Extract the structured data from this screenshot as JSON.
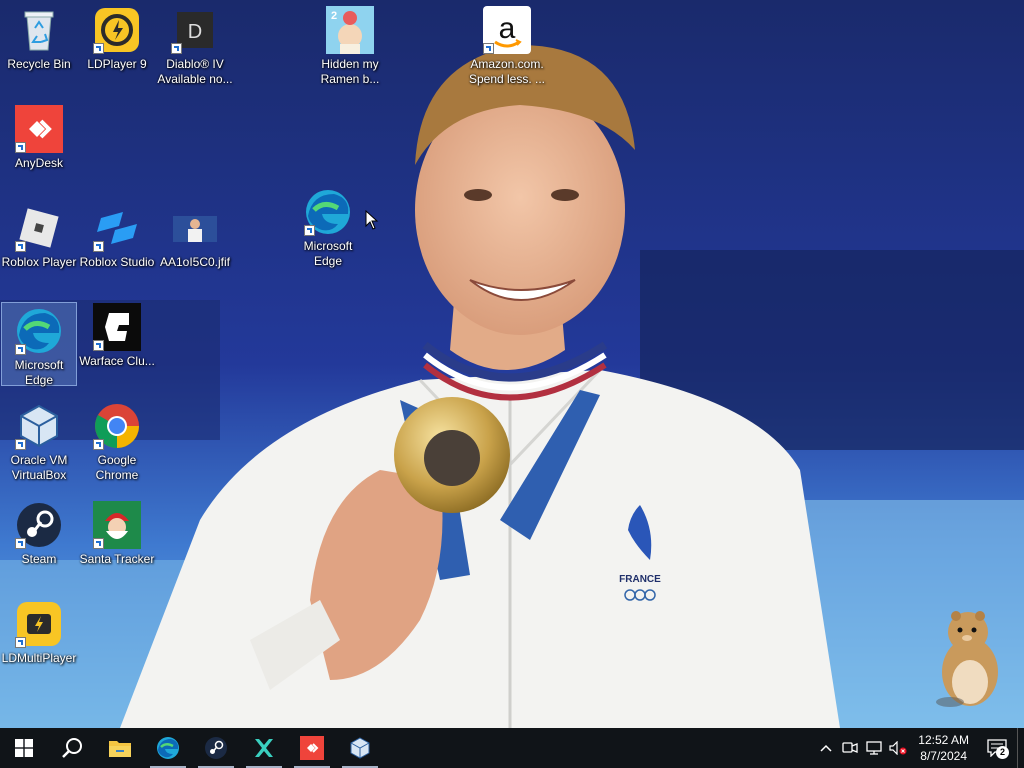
{
  "desktop": {
    "icons": [
      {
        "label": "Recycle Bin",
        "icon": "recycle-bin-icon"
      },
      {
        "label": "LDPlayer 9",
        "icon": "ldplayer-icon"
      },
      {
        "label": "Diablo® IV Available no...",
        "icon": "diablo-icon",
        "glyph": "D"
      },
      {
        "label": "Hidden my Ramen b...",
        "icon": "ramen-game-icon",
        "glyph": "2"
      },
      {
        "label": "Amazon.com. Spend less. ...",
        "icon": "amazon-icon",
        "glyph": "a"
      },
      {
        "label": "AnyDesk",
        "icon": "anydesk-icon"
      },
      {
        "label": "Roblox Player",
        "icon": "roblox-player-icon"
      },
      {
        "label": "Roblox Studio",
        "icon": "roblox-studio-icon"
      },
      {
        "label": "AA1oI5C0.jfif",
        "icon": "image-file-icon"
      },
      {
        "label": "Microsoft Edge",
        "icon": "edge-icon"
      },
      {
        "label": "Microsoft Edge",
        "icon": "edge-icon"
      },
      {
        "label": "Warface Clu...",
        "icon": "warface-icon"
      },
      {
        "label": "Oracle VM VirtualBox",
        "icon": "virtualbox-icon"
      },
      {
        "label": "Google Chrome",
        "icon": "chrome-icon"
      },
      {
        "label": "Steam",
        "icon": "steam-icon"
      },
      {
        "label": "Santa Tracker",
        "icon": "santa-tracker-icon"
      },
      {
        "label": "LDMultiPlayer",
        "icon": "ldmultiplayer-icon"
      }
    ],
    "selected": "Microsoft Edge"
  },
  "wallpaper": {
    "medal_country_text": "FRANCE"
  },
  "taskbar": {
    "pinned": [
      "start-icon",
      "search-icon",
      "file-explorer-icon",
      "edge-icon",
      "steam-icon",
      "x-app-icon",
      "anydesk-icon",
      "virtualbox-icon"
    ],
    "tray": {
      "time": "12:52 AM",
      "date": "8/7/2024",
      "notification_count": "2"
    }
  },
  "colors": {
    "taskbar": "#101418",
    "selection": "#78a0dc",
    "accent": "#1f6fd1"
  }
}
